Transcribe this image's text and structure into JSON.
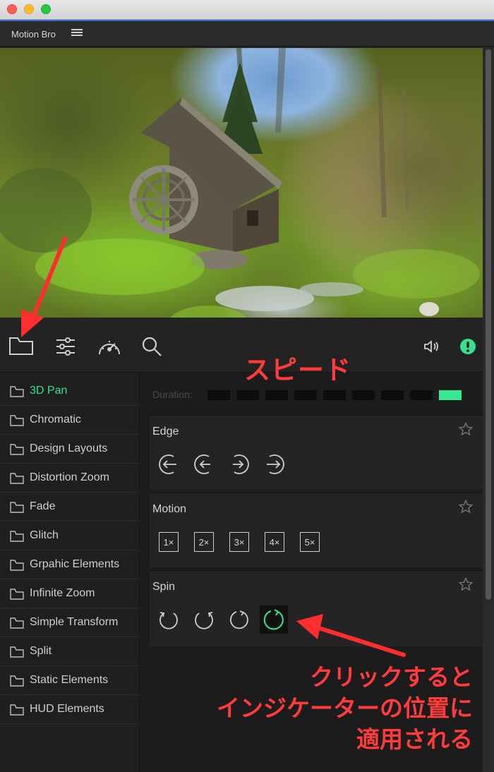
{
  "window": {
    "traffic_lights": [
      "close",
      "minimize",
      "zoom"
    ]
  },
  "panel": {
    "title": "Motion Bro",
    "menu_icon": "hamburger-icon"
  },
  "preview": {
    "description_icon": "watermill-landscape-image"
  },
  "toolbar": {
    "left_icons": [
      "folder-icon",
      "sliders-icon",
      "speedometer-icon",
      "search-icon"
    ],
    "right_icons": [
      "speaker-icon",
      "alert-icon"
    ],
    "alert_color": "#35e08e"
  },
  "sidebar": {
    "items": [
      {
        "label": "3D Pan",
        "active": true
      },
      {
        "label": "Chromatic",
        "active": false
      },
      {
        "label": "Design Layouts",
        "active": false
      },
      {
        "label": "Distortion Zoom",
        "active": false
      },
      {
        "label": "Fade",
        "active": false
      },
      {
        "label": "Glitch",
        "active": false
      },
      {
        "label": "Grpahic Elements",
        "active": false
      },
      {
        "label": "Infinite Zoom",
        "active": false
      },
      {
        "label": "Simple Transform",
        "active": false
      },
      {
        "label": "Split",
        "active": false
      },
      {
        "label": "Static Elements",
        "active": false
      },
      {
        "label": "HUD Elements",
        "active": false
      }
    ],
    "active_color": "#34e28f"
  },
  "duration": {
    "label": "Duration:",
    "segments": 9,
    "selected_segment": 9,
    "accent": "#36e88e"
  },
  "sections": [
    {
      "title": "Edge",
      "buttons": [
        "edge-left-1-icon",
        "edge-left-2-icon",
        "edge-right-1-icon",
        "edge-right-2-icon"
      ]
    },
    {
      "title": "Motion",
      "buttons": [
        "1×",
        "2×",
        "3×",
        "4×",
        "5×"
      ]
    },
    {
      "title": "Spin",
      "buttons": [
        "spin-ccw-icon",
        "spin-cw-icon",
        "spin-cw-open-icon",
        "spin-active-icon"
      ],
      "selected": 3
    }
  ],
  "annotations": {
    "speed_label": "スピード",
    "note_lines": [
      "クリックすると",
      "インジケーターの位置に",
      "適用される"
    ],
    "color": "#ff3b3b"
  }
}
